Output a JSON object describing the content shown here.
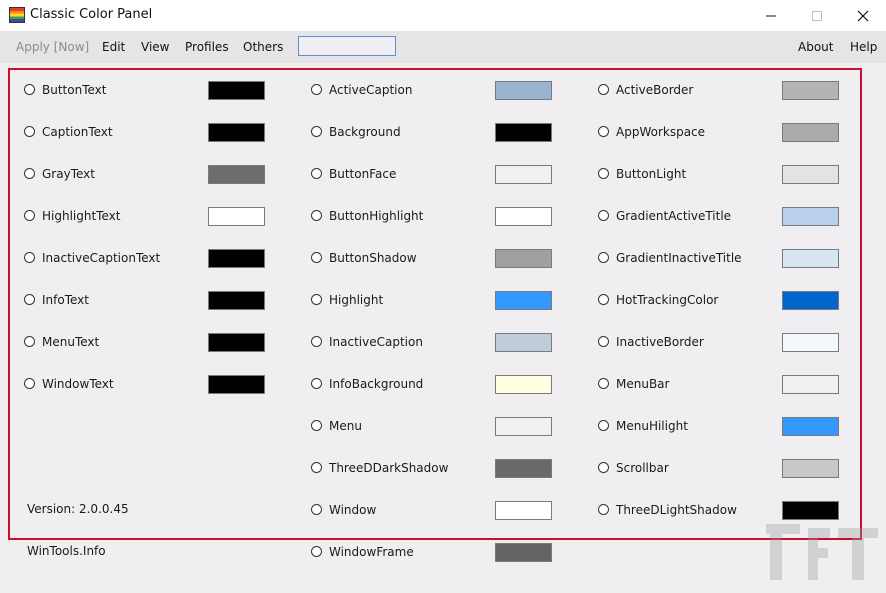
{
  "window": {
    "title": "Classic Color Panel"
  },
  "menu": {
    "apply": "Apply [Now]",
    "edit": "Edit",
    "view": "View",
    "profiles": "Profiles",
    "others": "Others",
    "about": "About",
    "help": "Help",
    "search_value": ""
  },
  "columns": [
    {
      "items": [
        {
          "name": "ButtonText",
          "color": "#000000"
        },
        {
          "name": "CaptionText",
          "color": "#000000"
        },
        {
          "name": "GrayText",
          "color": "#6d6d6d"
        },
        {
          "name": "HighlightText",
          "color": "#ffffff"
        },
        {
          "name": "InactiveCaptionText",
          "color": "#000000"
        },
        {
          "name": "InfoText",
          "color": "#000000"
        },
        {
          "name": "MenuText",
          "color": "#000000"
        },
        {
          "name": "WindowText",
          "color": "#000000"
        }
      ]
    },
    {
      "items": [
        {
          "name": "ActiveCaption",
          "color": "#99b4d1"
        },
        {
          "name": "Background",
          "color": "#000000"
        },
        {
          "name": "ButtonFace",
          "color": "#f0f0f0"
        },
        {
          "name": "ButtonHighlight",
          "color": "#ffffff"
        },
        {
          "name": "ButtonShadow",
          "color": "#a0a0a0"
        },
        {
          "name": "Highlight",
          "color": "#3399ff"
        },
        {
          "name": "InactiveCaption",
          "color": "#bfcddb"
        },
        {
          "name": "InfoBackground",
          "color": "#ffffe1"
        },
        {
          "name": "Menu",
          "color": "#f0f0f0"
        },
        {
          "name": "ThreeDDarkShadow",
          "color": "#696969"
        },
        {
          "name": "Window",
          "color": "#ffffff"
        },
        {
          "name": "WindowFrame",
          "color": "#646464"
        }
      ]
    },
    {
      "items": [
        {
          "name": "ActiveBorder",
          "color": "#b4b4b4"
        },
        {
          "name": "AppWorkspace",
          "color": "#ababab"
        },
        {
          "name": "ButtonLight",
          "color": "#e3e3e3"
        },
        {
          "name": "GradientActiveTitle",
          "color": "#b9d1ea"
        },
        {
          "name": "GradientInactiveTitle",
          "color": "#d7e4f2"
        },
        {
          "name": "HotTrackingColor",
          "color": "#0066cc"
        },
        {
          "name": "InactiveBorder",
          "color": "#f4f7fc"
        },
        {
          "name": "MenuBar",
          "color": "#f0f0f0"
        },
        {
          "name": "MenuHilight",
          "color": "#3399ff"
        },
        {
          "name": "Scrollbar",
          "color": "#c8c8c8"
        },
        {
          "name": "ThreeDLightShadow",
          "color": "#000000"
        }
      ]
    }
  ],
  "footer": {
    "version": "Version: 2.0.0.45",
    "site": "WinTools.Info"
  }
}
